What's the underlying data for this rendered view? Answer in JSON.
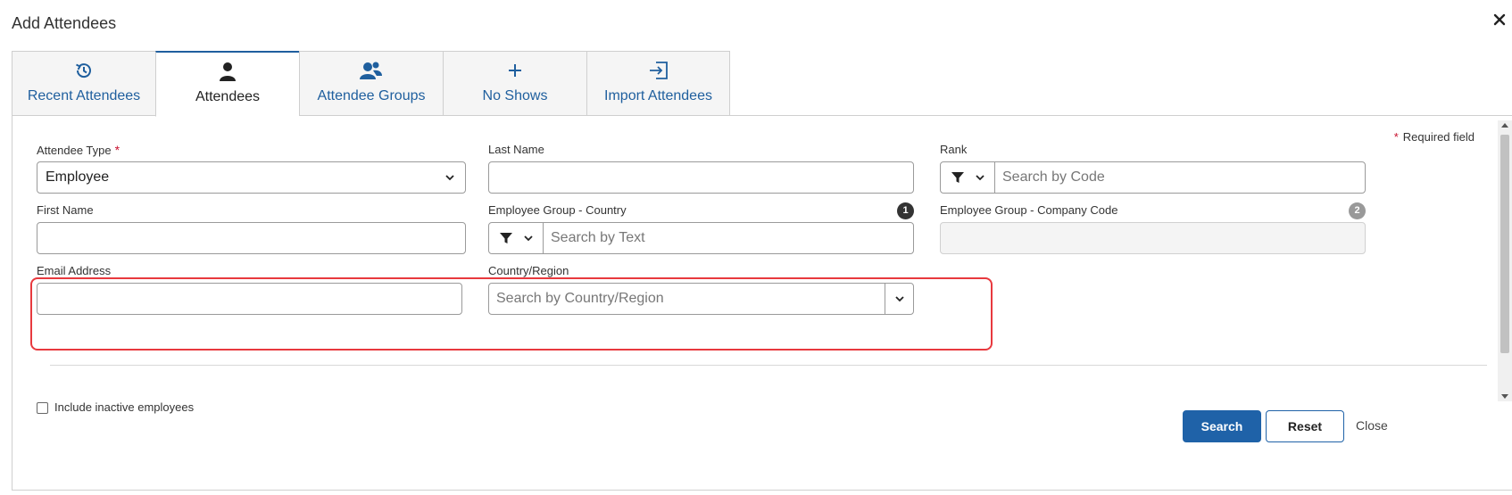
{
  "dialog": {
    "title": "Add Attendees"
  },
  "tabs": [
    {
      "label": "Recent Attendees",
      "icon": "history-icon"
    },
    {
      "label": "Attendees",
      "icon": "person-icon"
    },
    {
      "label": "Attendee Groups",
      "icon": "group-icon"
    },
    {
      "label": "No Shows",
      "icon": "plus-icon"
    },
    {
      "label": "Import Attendees",
      "icon": "import-icon"
    }
  ],
  "active_tab": "Attendees",
  "form": {
    "required_note": "Required field",
    "attendee_type": {
      "label": "Attendee Type",
      "value": "Employee"
    },
    "last_name": {
      "label": "Last Name",
      "value": ""
    },
    "rank": {
      "label": "Rank",
      "placeholder": "Search by Code"
    },
    "first_name": {
      "label": "First Name",
      "value": ""
    },
    "emp_group_country": {
      "label": "Employee Group - Country",
      "placeholder": "Search by Text",
      "badge": "1"
    },
    "emp_group_company": {
      "label": "Employee Group - Company Code",
      "badge": "2"
    },
    "email": {
      "label": "Email Address",
      "value": ""
    },
    "country_region": {
      "label": "Country/Region",
      "placeholder": "Search by Country/Region"
    },
    "include_inactive": {
      "label": "Include inactive employees",
      "checked": false
    }
  },
  "buttons": {
    "search": "Search",
    "reset": "Reset",
    "close": "Close"
  },
  "colors": {
    "accent": "#1f62a8",
    "highlight": "#e8393e",
    "required": "#c8102e"
  }
}
